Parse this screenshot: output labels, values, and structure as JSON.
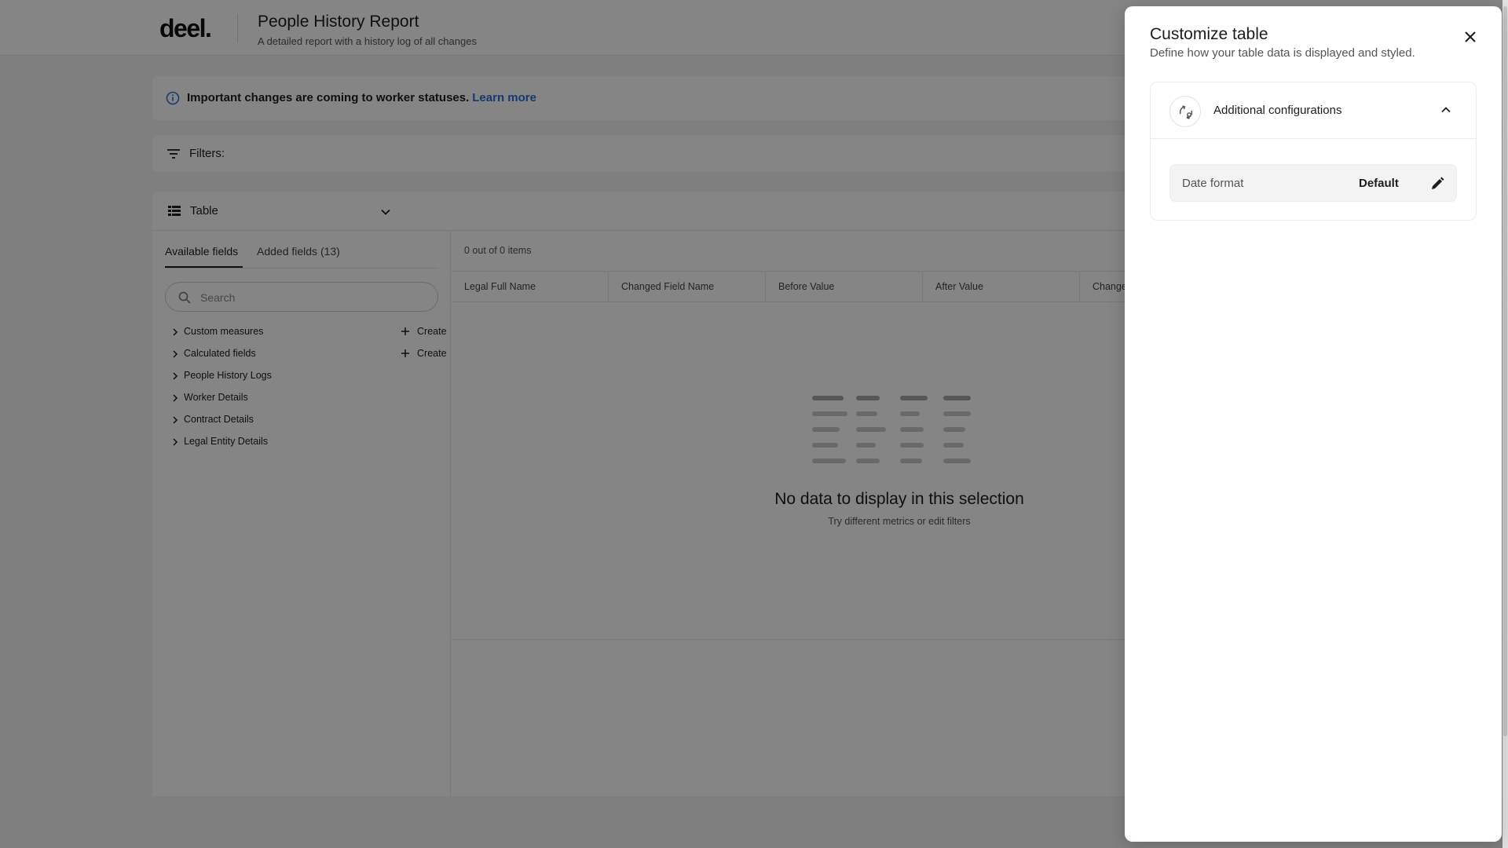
{
  "header": {
    "logo": "deel.",
    "title": "People History Report",
    "subtitle": "A detailed report with a history log of all changes"
  },
  "banner": {
    "text": "Important changes are coming to worker statuses.",
    "link": "Learn more"
  },
  "filters": {
    "label": "Filters:"
  },
  "view": {
    "label": "Table"
  },
  "fields_panel": {
    "tabs": [
      {
        "label": "Available fields",
        "active": true
      },
      {
        "label": "Added fields (13)",
        "active": false
      }
    ],
    "search_placeholder": "Search",
    "groups": [
      {
        "label": "Custom measures",
        "action": "Create"
      },
      {
        "label": "Calculated fields",
        "action": "Create"
      },
      {
        "label": "People History Logs"
      },
      {
        "label": "Worker Details"
      },
      {
        "label": "Contract Details"
      },
      {
        "label": "Legal Entity Details"
      }
    ]
  },
  "table": {
    "items_count": "0 out of 0 items",
    "columns": [
      "Legal Full Name",
      "Changed Field Name",
      "Before Value",
      "After Value",
      "Change"
    ],
    "empty_title": "No data to display in this selection",
    "empty_subtitle": "Try different metrics or edit filters"
  },
  "drawer": {
    "title": "Customize table",
    "subtitle": "Define how your table data is displayed and styled.",
    "section": {
      "label": "Additional configurations",
      "icon": "sync-settings-icon",
      "expanded": true
    },
    "date_format": {
      "label": "Date format",
      "value": "Default"
    }
  },
  "colors": {
    "link": "#2870d6",
    "overlay": "rgba(0,0,0,0.48)",
    "surface": "#ffffff",
    "background": "#f3f3f3"
  }
}
